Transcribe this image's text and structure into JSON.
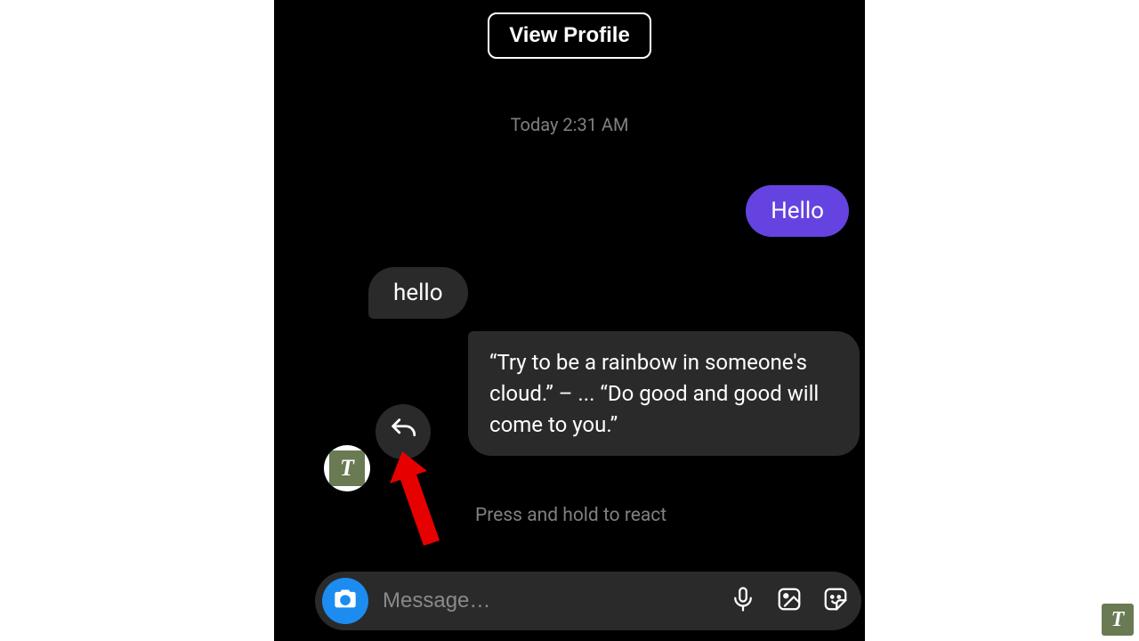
{
  "header": {
    "view_profile_label": "View Profile"
  },
  "timestamp": "Today 2:31 AM",
  "messages": {
    "outgoing_1": "Hello",
    "incoming_1": "hello",
    "incoming_2": "“Try to be a rainbow in someone's cloud.” – ... “Do good and good will come to you.”"
  },
  "hint": "Press and hold to react",
  "avatar_letter": "T",
  "input": {
    "placeholder": "Message…"
  },
  "watermark_letter": "T",
  "colors": {
    "outgoing_bubble": "#6543e0",
    "incoming_bubble": "#2a2a2a",
    "camera_button": "#1c8cf0",
    "arrow": "#e60000"
  }
}
